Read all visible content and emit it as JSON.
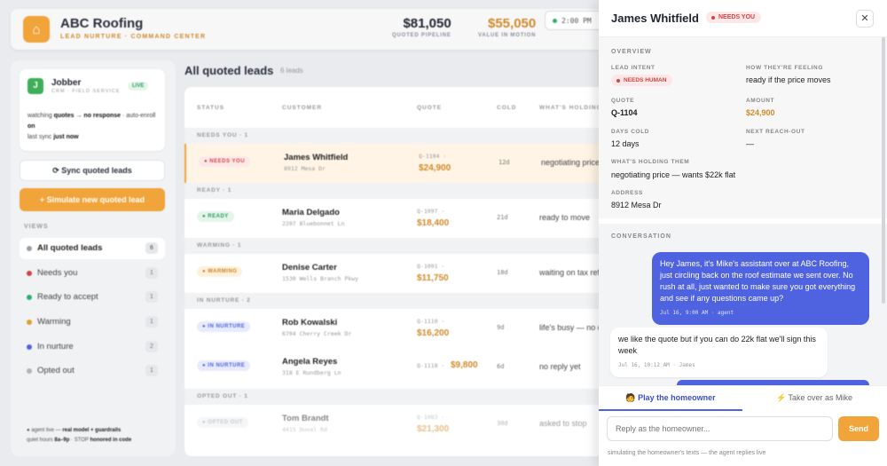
{
  "header": {
    "brand_title": "ABC Roofing",
    "brand_subtitle": "LEAD NURTURE · COMMAND CENTER",
    "quoted_pipeline_value": "$81,050",
    "quoted_pipeline_label": "QUOTED PIPELINE",
    "in_motion_value": "$55,050",
    "in_motion_label": "VALUE IN MOTION",
    "clock": "2:00 PM",
    "colors": {
      "accent": "#f0a43a",
      "brand_text": "#d08a2a"
    }
  },
  "sidebar": {
    "integration": {
      "name": "Jobber",
      "subtitle": "CRM · FIELD SERVICE",
      "status": "LIVE",
      "line1_pre": "watching ",
      "line1_b1": "quotes → no response",
      "line1_mid": " · auto-enroll ",
      "line1_b2": "on",
      "line2_pre": "last sync ",
      "line2_b": "just now"
    },
    "sync_button": "⟳ Sync quoted leads",
    "simulate_button": "+ Simulate new quoted lead",
    "views_header": "VIEWS",
    "views": [
      {
        "label": "All quoted leads",
        "count": "6",
        "color": "#9aa0a8"
      },
      {
        "label": "Needs you",
        "count": "1",
        "color": "#d04545"
      },
      {
        "label": "Ready to accept",
        "count": "1",
        "color": "#2fae6e"
      },
      {
        "label": "Warming",
        "count": "1",
        "color": "#e0a030"
      },
      {
        "label": "In nurture",
        "count": "2",
        "color": "#4f63e0"
      },
      {
        "label": "Opted out",
        "count": "1",
        "color": "#b0b4ba"
      }
    ],
    "footer": {
      "l1_pre": "● agent live — ",
      "l1_b": "real model + guardrails",
      "l2_pre": "quiet hours ",
      "l2_b1": "8a–9p",
      "l2_mid": " · STOP ",
      "l2_b2": "honored in code"
    }
  },
  "main": {
    "title": "All quoted leads",
    "count": "6 leads",
    "columns": [
      "STATUS",
      "CUSTOMER",
      "QUOTE",
      "COLD",
      "WHAT'S HOLDING"
    ],
    "groups": [
      {
        "label": "NEEDS YOU · 1"
      },
      {
        "label": "READY · 1"
      },
      {
        "label": "WARMING · 1"
      },
      {
        "label": "IN NURTURE · 2"
      },
      {
        "label": "OPTED OUT · 1"
      }
    ],
    "rows": [
      {
        "status": "● NEEDS YOU",
        "name": "James Whitfield",
        "addr": "8912 Mesa Dr",
        "quote": "Q-1104 ·",
        "amount": "$24,900",
        "cold": "12d",
        "holding": "negotiating price"
      },
      {
        "status": "● READY",
        "name": "Maria Delgado",
        "addr": "2207 Bluebonnet Ln",
        "quote": "Q-1097 ·",
        "amount": "$18,400",
        "cold": "21d",
        "holding": "ready to move"
      },
      {
        "status": "● WARMING",
        "name": "Denise Carter",
        "addr": "1530 Wells Branch Pkwy",
        "quote": "Q-1091 ·",
        "amount": "$11,750",
        "cold": "18d",
        "holding": "waiting on tax ref"
      },
      {
        "status": "● IN NURTURE",
        "name": "Rob Kowalski",
        "addr": "6704 Cherry Creek Dr",
        "quote": "Q-1110 ·",
        "amount": "$16,200",
        "cold": "9d",
        "holding": "life's busy — no c"
      },
      {
        "status": "● IN NURTURE",
        "name": "Angela Reyes",
        "addr": "318 E Rundberg Ln",
        "quote": "Q-1118 ·",
        "amount": "$9,800",
        "cold": "6d",
        "holding": "no reply yet"
      },
      {
        "status": "● OPTED OUT",
        "name": "Tom Brandt",
        "addr": "4415 Duval Rd",
        "quote": "Q-1083 ·",
        "amount": "$21,300",
        "cold": "30d",
        "holding": "asked to stop"
      }
    ]
  },
  "panel": {
    "name": "James Whitfield",
    "badge": "NEEDS YOU",
    "close": "✕",
    "overview_header": "OVERVIEW",
    "fields": {
      "intent_label": "LEAD INTENT",
      "intent_value": "NEEDS HUMAN",
      "feeling_label": "HOW THEY'RE FEELING",
      "feeling_value": "ready if the price moves",
      "quote_label": "QUOTE",
      "quote_value": "Q-1104",
      "amount_label": "AMOUNT",
      "amount_value": "$24,900",
      "cold_label": "DAYS COLD",
      "cold_value": "12 days",
      "reach_label": "NEXT REACH-OUT",
      "reach_value": "—",
      "holding_label": "WHAT'S HOLDING THEM",
      "holding_value": "negotiating price — wants $22k flat",
      "address_label": "ADDRESS",
      "address_value": "8912 Mesa Dr"
    },
    "conversation_header": "CONVERSATION",
    "messages": [
      {
        "text": "Hey James, it's Mike's assistant over at ABC Roofing, just circling back on the roof estimate we sent over. No rush at all, just wanted to make sure you got everything and see if any questions came up?",
        "ts": "Jul 16, 9:00 AM · agent"
      },
      {
        "text": "we like the quote but if you can do 22k flat we'll sign this week",
        "ts": "Jul 16, 10:12 AM · James"
      }
    ],
    "tab_homeowner": "🧑 Play the homeowner",
    "tab_takeover": "⚡ Take over as Mike",
    "reply_placeholder": "Reply as the homeowner...",
    "send": "Send",
    "hint": "simulating the homeowner's texts — the agent replies live"
  }
}
